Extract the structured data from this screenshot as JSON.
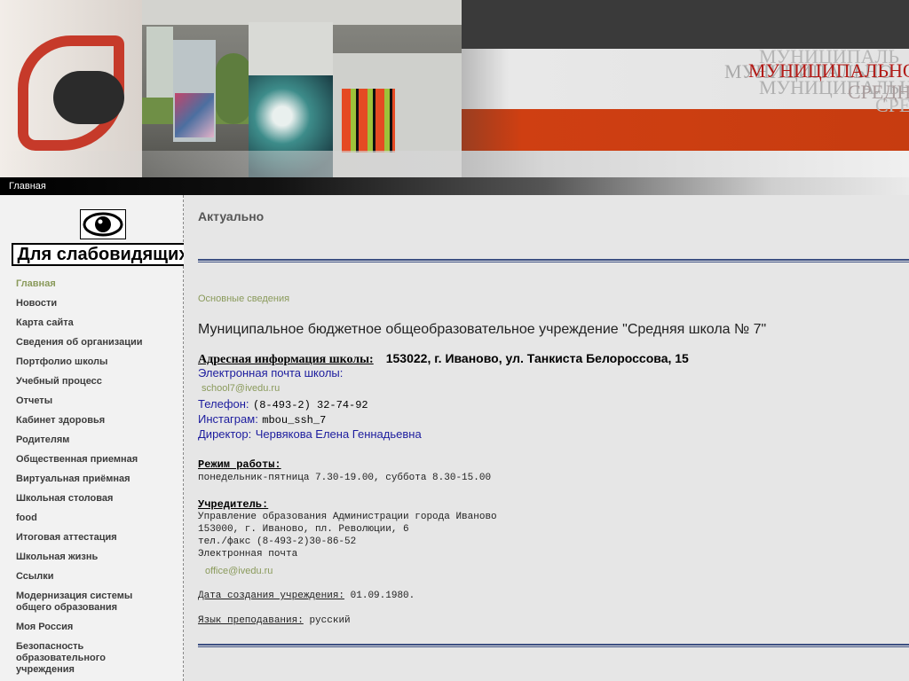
{
  "banner": {
    "title_line1": "МУНИЦИПАЛЬНО",
    "title_line2": "СРЕДН",
    "shadow1": "МУНИЦИПАЛЬ",
    "shadow2": "МУНИЦИПАЛЬНО",
    "shadow3": "МУНИЦИПАЛЬН",
    "shadow4": "СРЕ"
  },
  "topnav": {
    "home": "Главная"
  },
  "sidebar": {
    "vision_button": "Для слабовидящих",
    "items": [
      {
        "label": "Главная",
        "active": true
      },
      {
        "label": "Новости"
      },
      {
        "label": "Карта сайта"
      },
      {
        "label": "Сведения об организации"
      },
      {
        "label": "Портфолио школы"
      },
      {
        "label": "Учебный процесс"
      },
      {
        "label": "Отчеты"
      },
      {
        "label": "Кабинет здоровья"
      },
      {
        "label": "Родителям"
      },
      {
        "label": "Общественная приемная"
      },
      {
        "label": "Виртуальная приёмная"
      },
      {
        "label": "Школьная столовая"
      },
      {
        "label": "food"
      },
      {
        "label": "Итоговая аттестация"
      },
      {
        "label": "Школьная жизнь"
      },
      {
        "label": "Ссылки"
      },
      {
        "label": "Модернизация системы общего образования"
      },
      {
        "label": "Моя Россия"
      },
      {
        "label": "Безопасность образовательного учреждения"
      }
    ]
  },
  "main": {
    "section_title": "Актуально",
    "crumb_link": "Основные сведения",
    "org_title": "Муниципальное бюджетное общеобразовательное учреждение \"Средняя  школа № 7\"",
    "address_label": "Адресная информация школы:",
    "address_value": "153022, г. Иваново, ул. Танкиста Белороссова,  15",
    "email_label": "Электронная почта школы:",
    "email_value": "school7@ivedu.ru",
    "phone_label": "Телефон:",
    "phone_value": "(8-493-2) 32-74-92",
    "insta_label": "Инстаграм:",
    "insta_value": "mbou_ssh_7",
    "director_label": "Директор:",
    "director_value": "Червякова Елена Геннадьевна",
    "hours_head": "Режим работы:",
    "hours_value": "понедельник-пятница 7.30-19.00, суббота 8.30-15.00",
    "founder_head": "Учредитель:",
    "founder_lines": [
      "Управление образования Администрации города Иваново",
      "153000, г. Иваново, пл. Революции, 6",
      "тел./факс (8-493-2)30-86-52",
      "Электронная почта"
    ],
    "founder_email": "office@ivedu.ru",
    "created_label": "Дата создания учреждения:",
    "created_value": "01.09.1980.",
    "lang_label": "Язык преподавания:",
    "lang_value": "русский"
  }
}
